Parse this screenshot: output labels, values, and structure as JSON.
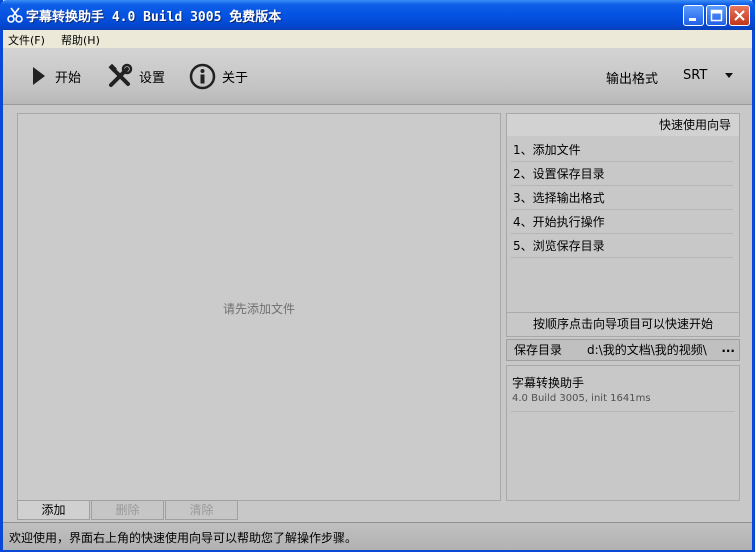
{
  "window": {
    "title": "字幕转换助手 4.0 Build 3005 免费版本",
    "icon": "scissors-icon"
  },
  "menu": {
    "items": [
      {
        "label": "文件(F)"
      },
      {
        "label": "帮助(H)"
      }
    ]
  },
  "toolbar": {
    "start_label": "开始",
    "settings_label": "设置",
    "about_label": "关于",
    "format_label": "输出格式",
    "format_value": "SRT"
  },
  "file_list": {
    "empty_message": "请先添加文件",
    "buttons": [
      {
        "label": "添加",
        "enabled": true
      },
      {
        "label": "删除",
        "enabled": false
      },
      {
        "label": "清除",
        "enabled": false
      }
    ]
  },
  "guide": {
    "title": "快速使用向导",
    "steps": [
      {
        "label": "1、添加文件"
      },
      {
        "label": "2、设置保存目录"
      },
      {
        "label": "3、选择输出格式"
      },
      {
        "label": "4、开始执行操作"
      },
      {
        "label": "5、浏览保存目录"
      }
    ],
    "footer": "按顺序点击向导项目可以快速开始"
  },
  "save_dir": {
    "label": "保存目录",
    "path": "d:\\我的文档\\我的视频\\",
    "browse": "..."
  },
  "info": {
    "name": "字幕转换助手",
    "version": "4.0 Build 3005, init 1641ms"
  },
  "status": {
    "text": "欢迎使用，界面右上角的快速使用向导可以帮助您了解操作步骤。"
  }
}
